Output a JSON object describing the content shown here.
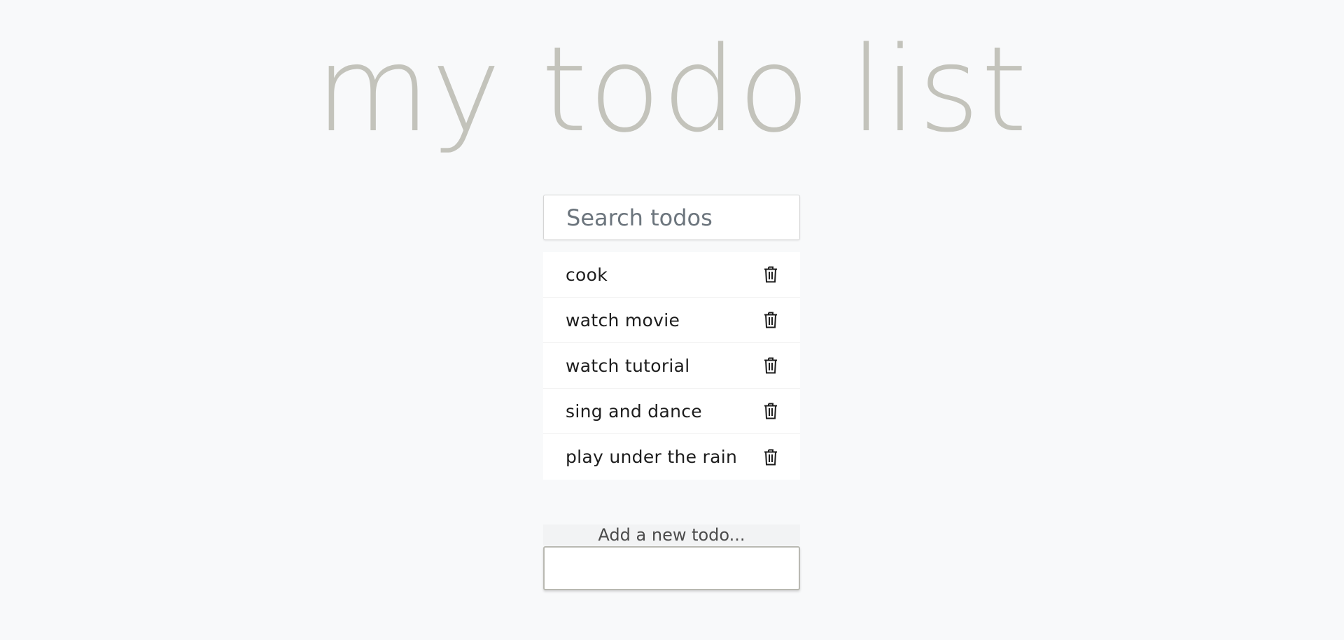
{
  "header": {
    "title": "my todo list"
  },
  "search": {
    "placeholder": "Search todos",
    "value": ""
  },
  "todos": [
    {
      "text": "cook",
      "icon": "trash-icon"
    },
    {
      "text": "watch movie",
      "icon": "trash-icon"
    },
    {
      "text": "watch tutorial",
      "icon": "trash-icon"
    },
    {
      "text": "sing and dance",
      "icon": "trash-icon"
    },
    {
      "text": "play under the rain",
      "icon": "trash-icon"
    }
  ],
  "add": {
    "label": "Add a new todo...",
    "value": ""
  },
  "colors": {
    "background": "#f8f9fa",
    "title": "#c3c3bb",
    "item_text": "#1d1d1d",
    "placeholder": "#6c757d"
  }
}
